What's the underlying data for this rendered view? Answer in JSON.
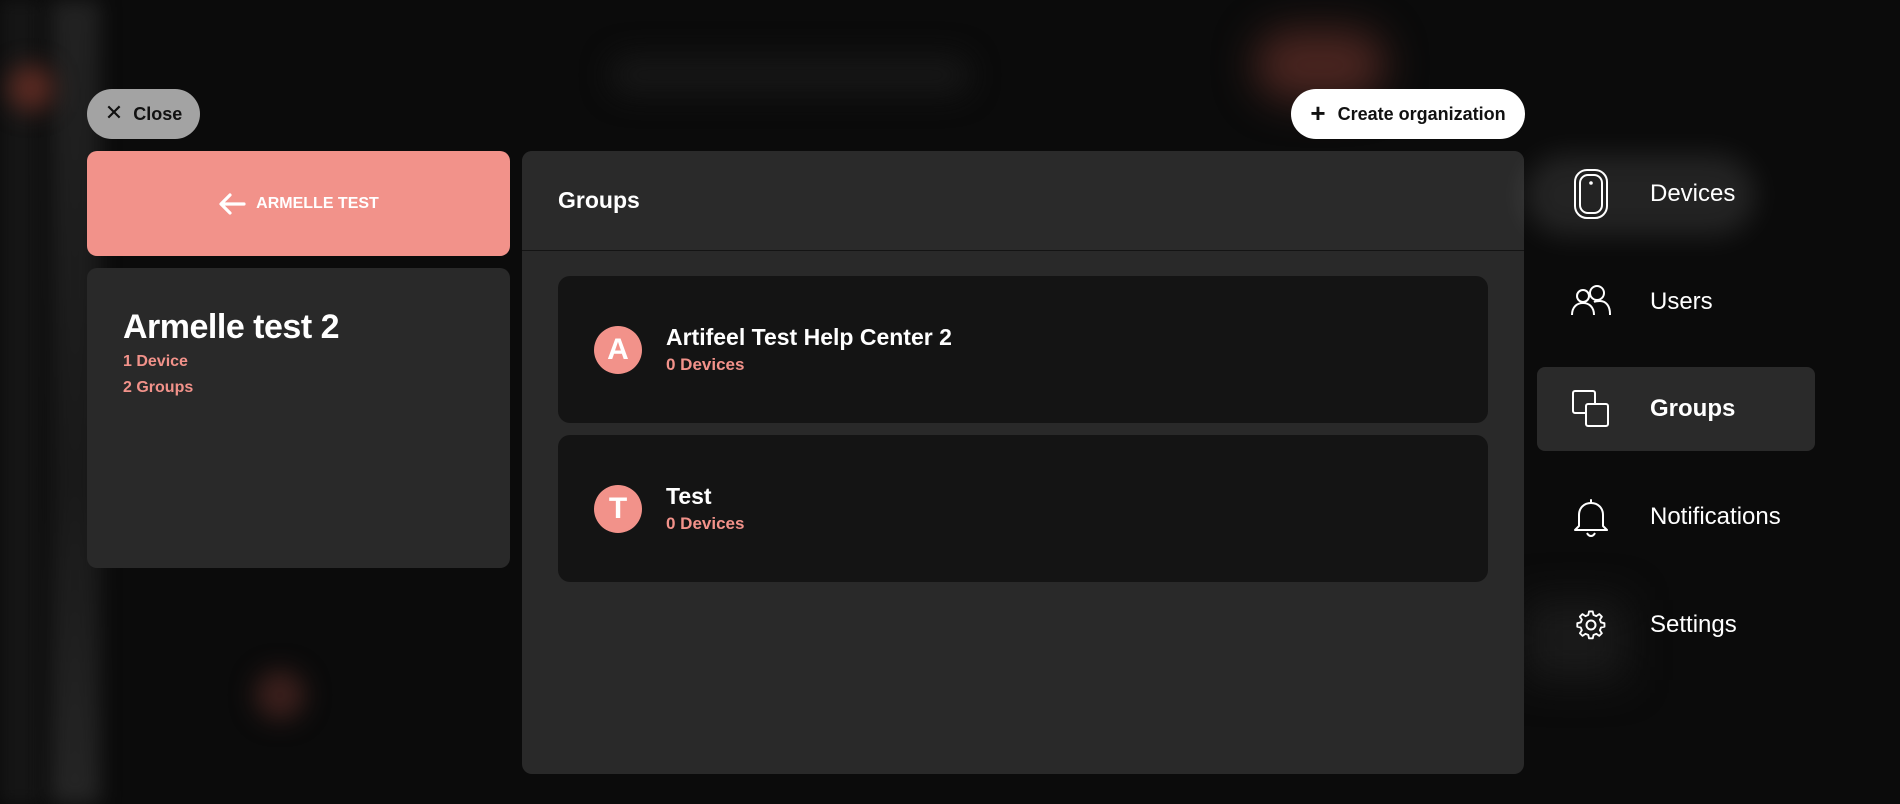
{
  "close_button": {
    "label": "Close"
  },
  "create_button": {
    "label": "Create organization"
  },
  "back_card": {
    "label": "ARMELLE TEST"
  },
  "organization": {
    "name": "Armelle test 2",
    "devices": "1 Device",
    "groups": "2 Groups"
  },
  "groups_panel": {
    "title": "Groups",
    "items": [
      {
        "initial": "A",
        "name": "Artifeel Test Help Center 2",
        "devices": "0 Devices"
      },
      {
        "initial": "T",
        "name": "Test",
        "devices": "0 Devices"
      }
    ]
  },
  "nav": {
    "items": [
      {
        "label": "Devices",
        "icon": "device-icon"
      },
      {
        "label": "Users",
        "icon": "users-icon"
      },
      {
        "label": "Groups",
        "icon": "groups-icon",
        "active": true
      },
      {
        "label": "Notifications",
        "icon": "bell-icon"
      },
      {
        "label": "Settings",
        "icon": "gear-icon"
      }
    ]
  },
  "colors": {
    "accent": "#f2928a",
    "panel": "#292929",
    "item": "#141414",
    "background": "#0b0b0b"
  }
}
